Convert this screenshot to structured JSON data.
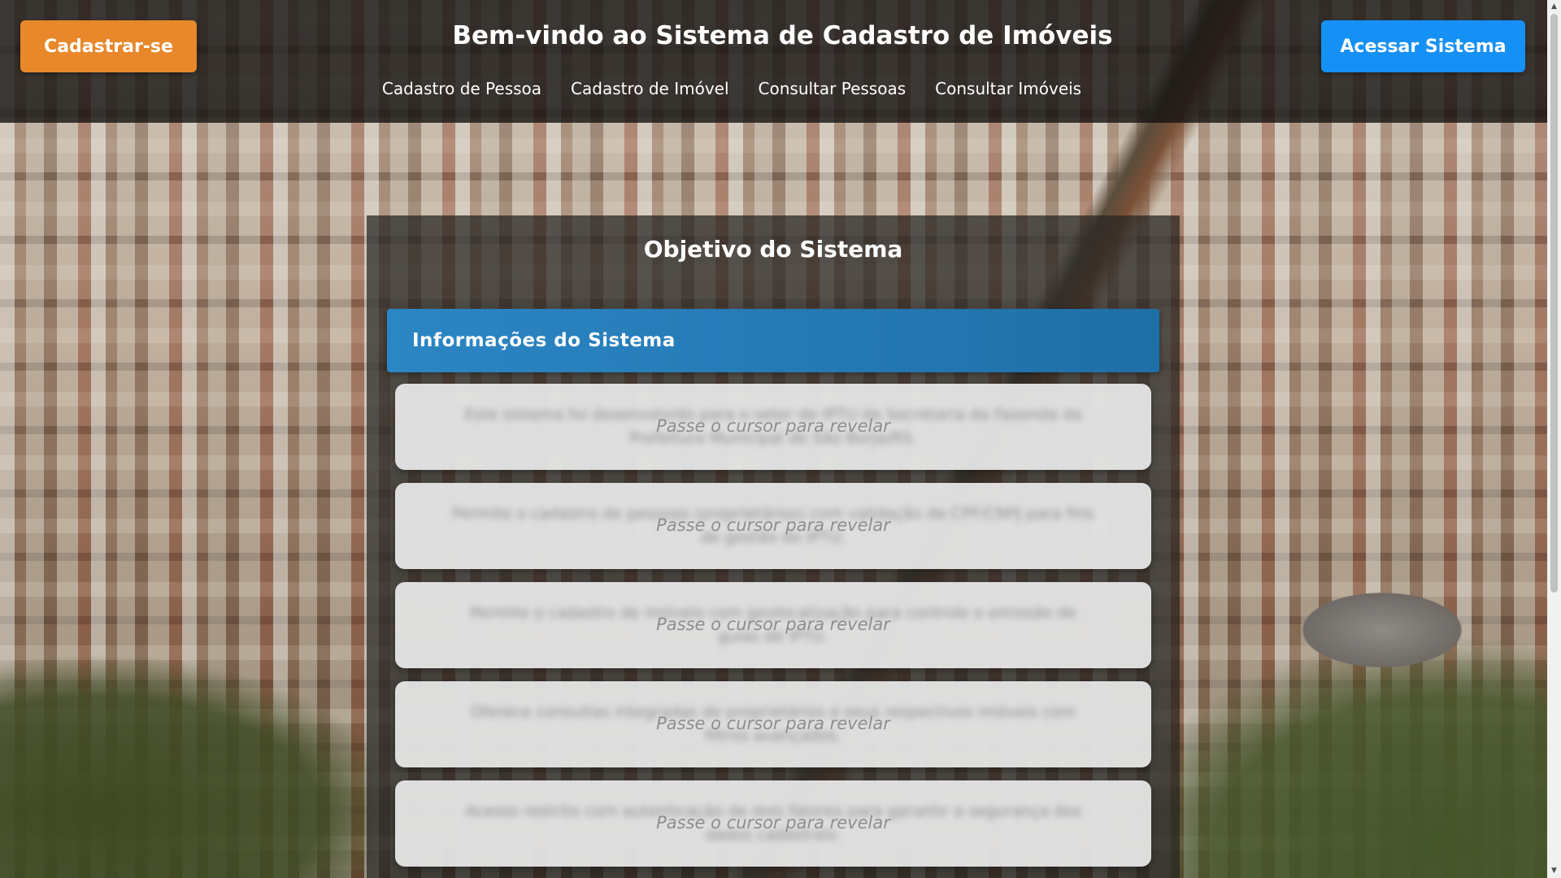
{
  "header": {
    "register_label": "Cadastrar-se",
    "title": "Bem-vindo ao Sistema de Cadastro de Imóveis",
    "access_label": "Acessar Sistema",
    "nav": [
      {
        "label": "Cadastro de Pessoa"
      },
      {
        "label": "Cadastro de Imóvel"
      },
      {
        "label": "Consultar Pessoas"
      },
      {
        "label": "Consultar Imóveis"
      }
    ]
  },
  "main": {
    "title": "Objetivo do Sistema",
    "info_header": "Informações do Sistema",
    "reveal_hint": "Passe o cursor para revelar",
    "cards": [
      {
        "text": "Este sistema foi desenvolvido para o setor de IPTU da Secretaria da Fazenda da Prefeitura Municipal de São Borja/RS."
      },
      {
        "text": "Permite o cadastro de pessoas (proprietários) com validação de CPF/CNPJ para fins de gestão do IPTU."
      },
      {
        "text": "Permite o cadastro de imóveis com geolocalização para controle e emissão de guias de IPTU."
      },
      {
        "text": "Oferece consultas integradas de proprietários e seus respectivos imóveis com filtros avançados."
      },
      {
        "text": "Acesso restrito com autenticação de dois fatores para garantir a segurança dos dados cadastrais."
      }
    ]
  },
  "colors": {
    "register_button": "#e8882a",
    "access_button": "#1590f5",
    "info_header": "#2b86c4"
  }
}
